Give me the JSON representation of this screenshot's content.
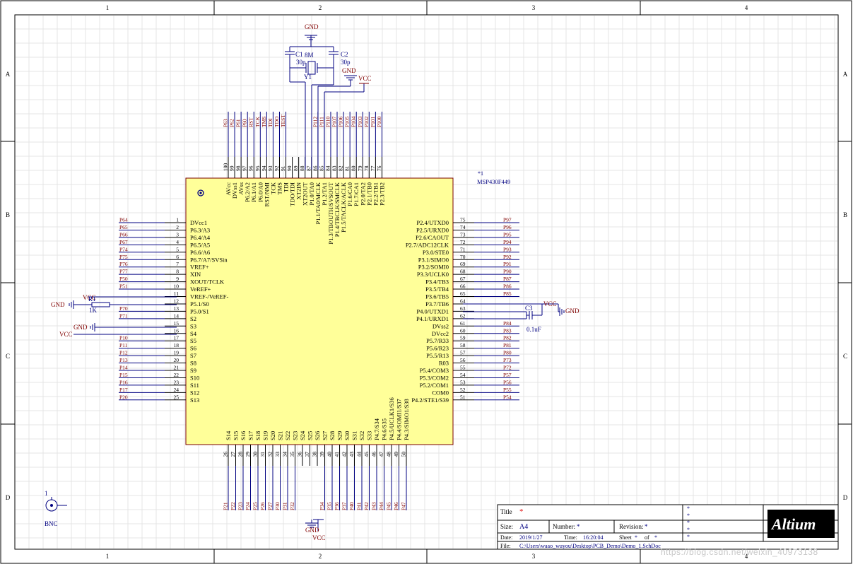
{
  "frame": {
    "col_labels": [
      "1",
      "2",
      "3",
      "4"
    ],
    "row_labels": [
      "A",
      "B",
      "C",
      "D"
    ]
  },
  "colors": {
    "border": "#000000",
    "grid": "#e4e4e4",
    "body_fill": "#ffff99",
    "body_stroke": "#7a0000",
    "wire": "#000080",
    "net_label": "#800000",
    "text_blue": "#000080",
    "pin": "#000000",
    "highlight_title": "#e01010"
  },
  "chip": {
    "designator": "*1",
    "part": "MSP430F449",
    "left_pins": [
      {
        "num": "1",
        "name": "DVcc1",
        "net": "P64"
      },
      {
        "num": "2",
        "name": "P6.3/A3",
        "net": "P65"
      },
      {
        "num": "3",
        "name": "P6.4/A4",
        "net": "P66"
      },
      {
        "num": "4",
        "name": "P6.5/A5",
        "net": "P67"
      },
      {
        "num": "5",
        "name": "P6.6/A6",
        "net": "P74"
      },
      {
        "num": "6",
        "name": "P6.7/A7/SVSin",
        "net": "P75"
      },
      {
        "num": "7",
        "name": "VREF+",
        "net": "P76"
      },
      {
        "num": "8",
        "name": "XIN",
        "net": "P77"
      },
      {
        "num": "9",
        "name": "XOUT/TCLK",
        "net": "P50"
      },
      {
        "num": "10",
        "name": "VeREF+",
        "net": "P51"
      },
      {
        "num": "11",
        "name": "VREF-/VeREF-",
        "net": ""
      },
      {
        "num": "12",
        "name": "P5.1/S0",
        "net": ""
      },
      {
        "num": "13",
        "name": "P5.0/S1",
        "net": "P70"
      },
      {
        "num": "14",
        "name": "S2",
        "net": "P71"
      },
      {
        "num": "15",
        "name": "S3",
        "net": ""
      },
      {
        "num": "16",
        "name": "S4",
        "net": ""
      },
      {
        "num": "17",
        "name": "S5",
        "net": "P10"
      },
      {
        "num": "18",
        "name": "S6",
        "net": "P11"
      },
      {
        "num": "19",
        "name": "S7",
        "net": "P12"
      },
      {
        "num": "20",
        "name": "S8",
        "net": "P13"
      },
      {
        "num": "21",
        "name": "S9",
        "net": "P14"
      },
      {
        "num": "22",
        "name": "S10",
        "net": "P15"
      },
      {
        "num": "23",
        "name": "S11",
        "net": "P16"
      },
      {
        "num": "24",
        "name": "S12",
        "net": "P17"
      },
      {
        "num": "25",
        "name": "S13",
        "net": "P20"
      }
    ],
    "right_pins": [
      {
        "num": "75",
        "name": "P2.4/UTXD0",
        "net": "P97"
      },
      {
        "num": "74",
        "name": "P2.5/URXD0",
        "net": "P96"
      },
      {
        "num": "73",
        "name": "P2.6/CAOUT",
        "net": "P95"
      },
      {
        "num": "72",
        "name": "P2.7/ADC12CLK",
        "net": "P94"
      },
      {
        "num": "71",
        "name": "P3.0/STE0",
        "net": "P93"
      },
      {
        "num": "70",
        "name": "P3.1/SIMO0",
        "net": "P92"
      },
      {
        "num": "69",
        "name": "P3.2/SOMI0",
        "net": "P91"
      },
      {
        "num": "68",
        "name": "P3.3/UCLK0",
        "net": "P90"
      },
      {
        "num": "67",
        "name": "P3.4/TB3",
        "net": "P87"
      },
      {
        "num": "66",
        "name": "P3.5/TB4",
        "net": "P86"
      },
      {
        "num": "65",
        "name": "P3.6/TB5",
        "net": "P85"
      },
      {
        "num": "64",
        "name": "P3.7/TB6",
        "net": ""
      },
      {
        "num": "63",
        "name": "P4.0/UTXD1",
        "net": ""
      },
      {
        "num": "62",
        "name": "P4.1/URXD1",
        "net": ""
      },
      {
        "num": "61",
        "name": "DVss2",
        "net": "P84"
      },
      {
        "num": "60",
        "name": "DVcc2",
        "net": "P83"
      },
      {
        "num": "59",
        "name": "P5.7/R33",
        "net": "P82"
      },
      {
        "num": "58",
        "name": "P5.6/R23",
        "net": "P81"
      },
      {
        "num": "57",
        "name": "P5.5/R13",
        "net": "P80"
      },
      {
        "num": "56",
        "name": "R03",
        "net": "P73"
      },
      {
        "num": "55",
        "name": "P5.4/COM3",
        "net": "P72"
      },
      {
        "num": "54",
        "name": "P5.3/COM2",
        "net": "P57"
      },
      {
        "num": "53",
        "name": "P5.2/COM1",
        "net": "P56"
      },
      {
        "num": "52",
        "name": "COM0",
        "net": "P55"
      },
      {
        "num": "51",
        "name": "P4.2/STE1/S39",
        "net": "P54"
      }
    ],
    "top_pins": [
      {
        "num": "100",
        "name": "AVcc",
        "net": "P63"
      },
      {
        "num": "99",
        "name": "DVss1",
        "net": "P62"
      },
      {
        "num": "98",
        "name": "AVss",
        "net": "P61"
      },
      {
        "num": "97",
        "name": "P6.2/A2",
        "net": "P60"
      },
      {
        "num": "96",
        "name": "P6.1/A1",
        "net": "RST"
      },
      {
        "num": "95",
        "name": "P6.0/A0",
        "net": "TCK"
      },
      {
        "num": "94",
        "name": "RST/NMI",
        "net": "TMS"
      },
      {
        "num": "93",
        "name": "TCK",
        "net": "TDI"
      },
      {
        "num": "92",
        "name": "TMS",
        "net": "TDO"
      },
      {
        "num": "91",
        "name": "TDI",
        "net": "TEST"
      },
      {
        "num": "90",
        "name": "TDO/TDI",
        "net": ""
      },
      {
        "num": "89",
        "name": "XT2IN",
        "net": ""
      },
      {
        "num": "88",
        "name": "XT2OUT",
        "net": ""
      },
      {
        "num": "87",
        "name": "P1.0/TA0",
        "net": ""
      },
      {
        "num": "86",
        "name": "P1.1/TA0/MCLK",
        "net": "P112"
      },
      {
        "num": "85",
        "name": "P1.2/TA1",
        "net": "P111"
      },
      {
        "num": "84",
        "name": "P1.3/TBOUTH/SVSOUT",
        "net": "P110"
      },
      {
        "num": "83",
        "name": "P1.4/TBCLK/SMCLK",
        "net": "P107"
      },
      {
        "num": "82",
        "name": "P1.5/TACLK/ACLK",
        "net": "P106"
      },
      {
        "num": "81",
        "name": "P1.6/CA0",
        "net": "P105"
      },
      {
        "num": "80",
        "name": "P1.7/CA1",
        "net": "P104"
      },
      {
        "num": "79",
        "name": "P2.0/TA2",
        "net": "P103"
      },
      {
        "num": "78",
        "name": "P2.1/TB0",
        "net": "P102"
      },
      {
        "num": "77",
        "name": "P2.2/TB1",
        "net": "P101"
      },
      {
        "num": "76",
        "name": "P2.3/TB2",
        "net": "P100"
      }
    ],
    "bottom_pins": [
      {
        "num": "26",
        "name": "S14",
        "net": "P21"
      },
      {
        "num": "27",
        "name": "S15",
        "net": "P22"
      },
      {
        "num": "28",
        "name": "S16",
        "net": "P23"
      },
      {
        "num": "29",
        "name": "S17",
        "net": "P24"
      },
      {
        "num": "30",
        "name": "S18",
        "net": "P25"
      },
      {
        "num": "31",
        "name": "S19",
        "net": "P26"
      },
      {
        "num": "32",
        "name": "S20",
        "net": "P27"
      },
      {
        "num": "33",
        "name": "S21",
        "net": "P30"
      },
      {
        "num": "34",
        "name": "S22",
        "net": "P31"
      },
      {
        "num": "35",
        "name": "S23",
        "net": "P32"
      },
      {
        "num": "36",
        "name": "S24",
        "net": ""
      },
      {
        "num": "37",
        "name": "S25",
        "net": ""
      },
      {
        "num": "38",
        "name": "S26",
        "net": ""
      },
      {
        "num": "39",
        "name": "S27",
        "net": "P34"
      },
      {
        "num": "40",
        "name": "S28",
        "net": "P35"
      },
      {
        "num": "41",
        "name": "S29",
        "net": "P36"
      },
      {
        "num": "42",
        "name": "S30",
        "net": "P37"
      },
      {
        "num": "43",
        "name": "S31",
        "net": "P40"
      },
      {
        "num": "44",
        "name": "S32",
        "net": "P41"
      },
      {
        "num": "45",
        "name": "S33",
        "net": "P42"
      },
      {
        "num": "46",
        "name": "P4.7/S34",
        "net": "P43"
      },
      {
        "num": "47",
        "name": "P4.6/S35",
        "net": "P44"
      },
      {
        "num": "48",
        "name": "P4.5/UCLK1/S36",
        "net": "P45"
      },
      {
        "num": "49",
        "name": "P4.4/SOMI1/S37",
        "net": "P46"
      },
      {
        "num": "50",
        "name": "P4.3/SIMO1/S38",
        "net": "P47"
      }
    ]
  },
  "crystal": {
    "c1_designator": "C1",
    "c1_value": "30p",
    "c2_designator": "C2",
    "c2_value": "30p",
    "y1_designator": "Y1",
    "y1_value": "8M",
    "gnd_label": "GND",
    "vcc_label": "VCC",
    "gnd2_label": "GND"
  },
  "left_parts": {
    "r1_designator": "R1",
    "r1_value": "1K",
    "vcc_label": "VCC",
    "gnd_label": "GND",
    "gnd2_label": "GND",
    "vcc2_label": "VCC"
  },
  "right_parts": {
    "c3_designator": "C3",
    "c3_value": "0.1uF",
    "vcc_label": "VCC",
    "gnd_label": "GND"
  },
  "bottom_power": {
    "gnd_label": "GND",
    "vcc_label": "VCC"
  },
  "bnc": {
    "pin_num": "1",
    "label": "BNC"
  },
  "title_block": {
    "title_label": "Title",
    "title_value": "*",
    "size_label": "Size:",
    "size_value": "A4",
    "number_label": "Number:",
    "number_value": "*",
    "revision_label": "Revision:",
    "revision_value": "*",
    "date_label": "Date:",
    "date_value": "2019/1/27",
    "time_label": "Time:",
    "time_value": "16:20:04",
    "sheet_label": "Sheet",
    "sheet_value": "*",
    "of_label": "of",
    "of_value": "*",
    "file_label": "File:",
    "file_value": "C:\\Users\\waao_wuyou\\Desktop\\PCB_Demo\\Demo_1.SchDoc",
    "stars": [
      "*",
      "*",
      "*",
      "*",
      "*"
    ],
    "logo_text": "Altium"
  },
  "watermark": "https://blog.csdn.net/weixin_40973138"
}
